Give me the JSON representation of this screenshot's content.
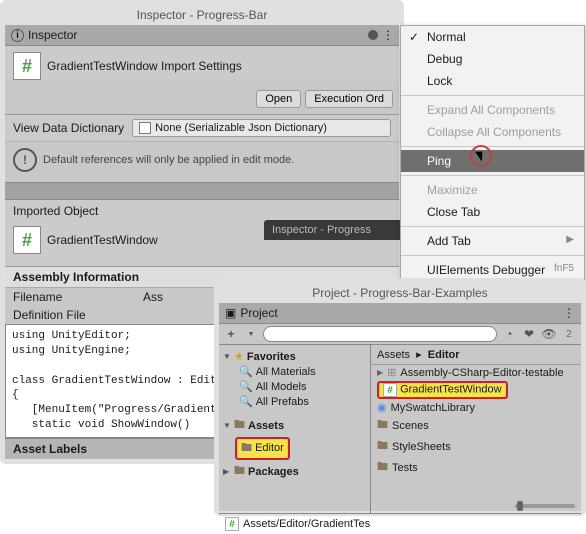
{
  "inspector": {
    "window_title": "Inspector - Progress-Bar",
    "tab": "Inspector",
    "object_title": "GradientTestWindow Import Settings",
    "open_btn": "Open",
    "exec_btn": "Execution Ord",
    "vdd_label": "View Data Dictionary",
    "vdd_value": "None (Serializable Json Dictionary)",
    "info_msg": "Default references will only be applied in edit mode.",
    "imported_label": "Imported Object",
    "imported_name": "GradientTestWindow",
    "dark_tab": "Inspector - Progress",
    "assembly_hdr": "Assembly Information",
    "filename_k": "Filename",
    "filename_v": "Ass",
    "deffile_k": "Definition File",
    "code": "using UnityEditor;\nusing UnityEngine;\n\nclass GradientTestWindow : EditorW\n{\n   [MenuItem(\"Progress/GradientTe\n   static void ShowWindow()",
    "asset_labels": "Asset Labels"
  },
  "menu": {
    "normal": "Normal",
    "debug": "Debug",
    "lock": "Lock",
    "expand": "Expand All Components",
    "collapse": "Collapse All Components",
    "ping": "Ping",
    "maximize": "Maximize",
    "close": "Close Tab",
    "addtab": "Add Tab",
    "uidbg": "UIElements Debugger",
    "uidbg_key": "fnF5"
  },
  "project": {
    "window_title": "Project - Progress-Bar-Examples",
    "tab": "Project",
    "plus": "+",
    "favorites": "Favorites",
    "fav_items": [
      "All Materials",
      "All Models",
      "All Prefabs"
    ],
    "assets": "Assets",
    "editor_folder": "Editor",
    "packages": "Packages",
    "crumb_assets": "Assets",
    "crumb_editor": "Editor",
    "files": {
      "csharp": "Assembly-CSharp-Editor-testable",
      "gtw": "GradientTestWindow",
      "swatch": "MySwatchLibrary",
      "scenes": "Scenes",
      "styles": "StyleSheets",
      "tests": "Tests"
    },
    "footer": "Assets/Editor/GradientTes"
  }
}
